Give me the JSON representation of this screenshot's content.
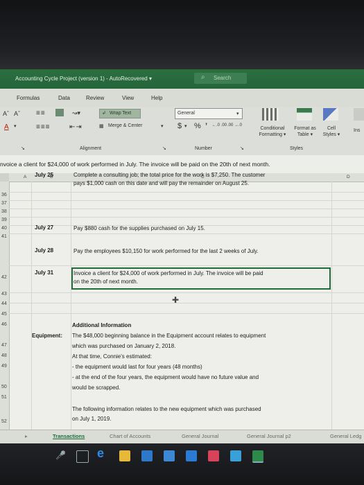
{
  "app": {
    "title": "Accounting Cycle Project (version 1)  -  AutoRecovered  ▾",
    "search_placeholder": "Search"
  },
  "menu": [
    "Formulas",
    "Data",
    "Review",
    "View",
    "Help"
  ],
  "ribbon": {
    "font_increase": "Aˆ",
    "font_decrease": "Aˇ",
    "wrap_text": "Wrap Text",
    "merge_center": "Merge & Center",
    "number_format": "General",
    "currency": "$",
    "percent": "%",
    "comma": "’",
    "inc_decimal": "←.0 .00",
    "dec_decimal": ".00 →.0",
    "conditional_formatting": "Conditional Formatting ▾",
    "format_as_table": "Format as Table ▾",
    "cell_styles": "Cell Styles ▾",
    "insert": "Ins",
    "group_alignment": "Alignment",
    "group_number": "Number",
    "group_styles": "Styles"
  },
  "formula_bar": {
    "content": "nvoice a client for $24,000 of work performed in July. The invoice will be paid on the 20th of next month."
  },
  "columns": [
    "A",
    "B",
    "C",
    "D"
  ],
  "rows": [
    "36",
    "37",
    "38",
    "39",
    "40",
    "41",
    "42",
    "43",
    "44",
    "45",
    "46",
    "47",
    "48",
    "49",
    "50",
    "51",
    "52"
  ],
  "entries": [
    {
      "date": "July 25",
      "desc": [
        "Complete a consulting job; the total price for the work is $7,250. The customer",
        "pays $1,000 cash on this date and will pay the remainder on August 25."
      ]
    },
    {
      "date": "July 27",
      "desc": [
        "Pay $880 cash for the supplies purchased on July 15."
      ]
    },
    {
      "date": "July 28",
      "desc": [
        "Pay the employees $10,150 for work performed for the last 2 weeks of July."
      ]
    },
    {
      "date": "July 31",
      "desc": [
        "Invoice a client for $24,000 of work performed in July. The invoice will be paid",
        "on the 20th of next month."
      ]
    }
  ],
  "additional": {
    "heading": "Additional Information",
    "label": "Equipment:",
    "lines": [
      "The $48,000 beginning balance in the Equipment account relates to equipment",
      "which was purchased on January 2, 2018.",
      "At that time, Connie's estimated:",
      " - the equipment would last for four years (48 months)",
      " - at the end of the four years, the equipment would have no future value and",
      "would be scrapped."
    ],
    "new_equipment": [
      "The following information relates to the new equipment which was purchased",
      "on July 1, 2019."
    ]
  },
  "sheet_tabs": [
    "Transactions",
    "Chart of Accounts",
    "General Journal",
    "General Journal p2",
    "General Ledg"
  ],
  "colors": {
    "excel_green": "#24653a",
    "ribbon": "#dcdfd9"
  }
}
